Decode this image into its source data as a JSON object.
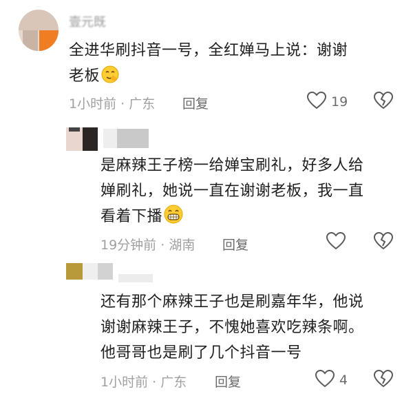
{
  "comments": [
    {
      "username": "壹元既",
      "lines": [
        "全进华刷抖音一号，全红婵马上说：谢谢",
        "老板"
      ],
      "time": "1小时前",
      "location": "广东",
      "reply_label": "回复",
      "like_count": "19"
    },
    {
      "lines": [
        "是麻辣王子榜一给婵宝刷礼，好多人给",
        "婵刷礼，她说一直在谢谢老板，我一直",
        "看着下播"
      ],
      "time": "19分钟前",
      "location": "湖南",
      "reply_label": "回复",
      "like_count": ""
    },
    {
      "lines": [
        "还有那个麻辣王子也是刷嘉年华，他说",
        "谢谢麻辣王子，不愧她喜欢吃辣条啊。",
        "他哥哥也是刷了几个抖音一号"
      ],
      "time": "1小时前",
      "location": "广东",
      "reply_label": "回复",
      "like_count": "4"
    }
  ],
  "separator": " · ",
  "colors": {
    "text": "#1f1f1f",
    "meta": "#a0a0a0",
    "icon": "#5a5a5a"
  },
  "icons": {
    "like": "heart-outline-icon",
    "dislike": "broken-heart-icon"
  }
}
